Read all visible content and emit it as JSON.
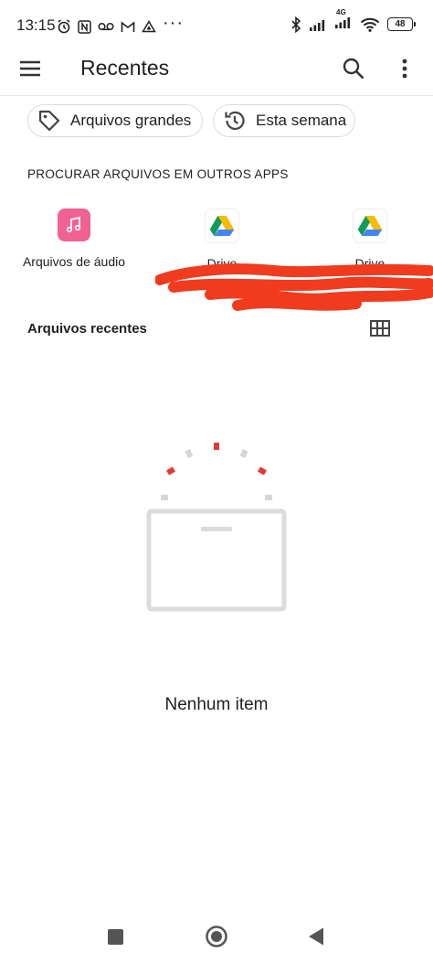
{
  "status_bar": {
    "time": "13:15",
    "more": "···",
    "network": "4G",
    "battery": "48"
  },
  "app_bar": {
    "title": "Recentes"
  },
  "chips": [
    {
      "label": "Arquivos grandes",
      "icon": "tag-icon"
    },
    {
      "label": "Esta semana",
      "icon": "history-icon"
    }
  ],
  "other_apps": {
    "heading": "PROCURAR ARQUIVOS EM OUTROS APPS",
    "items": [
      {
        "label": "Arquivos de áudio",
        "icon": "music-note-icon",
        "color": "#f06292"
      },
      {
        "label": "Drive",
        "icon": "google-drive-icon"
      },
      {
        "label": "Drive",
        "icon": "google-drive-icon"
      }
    ]
  },
  "recent": {
    "heading": "Arquivos recentes",
    "empty_message": "Nenhum item"
  },
  "colors": {
    "accent_red": "#e53935",
    "redaction": "#f03b1f"
  }
}
